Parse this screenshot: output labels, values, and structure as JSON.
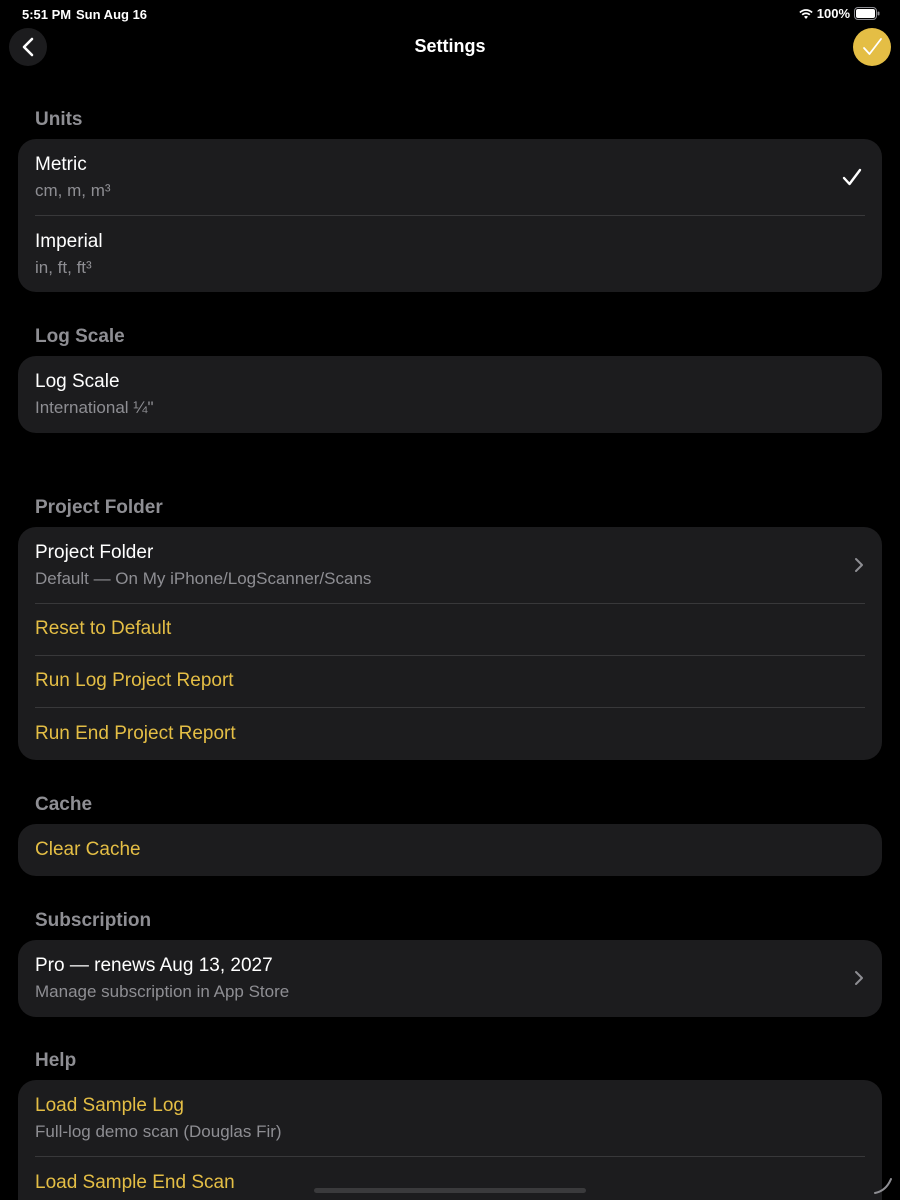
{
  "status": {
    "time": "5:51 PM",
    "date": "Sun Aug 16",
    "battery": "100%"
  },
  "nav": {
    "title": "Settings"
  },
  "units": {
    "header": "Units",
    "metric_title": "Metric",
    "metric_sub": "cm, m, m³",
    "imperial_title": "Imperial",
    "imperial_sub": "in, ft, ft³"
  },
  "log_scale": {
    "header": "Log Scale",
    "title": "Log Scale",
    "value": "International ¼\""
  },
  "project_folder": {
    "header": "Project Folder",
    "title": "Project Folder",
    "value": "Default — On My iPhone/LogScanner/Scans",
    "reset": "Reset to Default",
    "run_log_report": "Run Log Project Report",
    "run_end_report": "Run End Project Report"
  },
  "cache": {
    "header": "Cache",
    "clear": "Clear Cache"
  },
  "subscription": {
    "header": "Subscription",
    "title": "Pro — renews Aug 13, 2027",
    "sub": "Manage subscription in App Store"
  },
  "help": {
    "header": "Help",
    "sample_log_title": "Load Sample Log",
    "sample_log_sub": "Full-log demo scan (Douglas Fir)",
    "sample_end_title": "Load Sample End Scan"
  },
  "colors": {
    "accent": "#e4be45",
    "background": "#000000",
    "card": "#1c1c1e",
    "secondary_text": "#8e8e93"
  },
  "icons": [
    "wifi-icon",
    "battery-icon",
    "chevron-left-icon",
    "checkmark-icon",
    "chevron-right-icon"
  ]
}
